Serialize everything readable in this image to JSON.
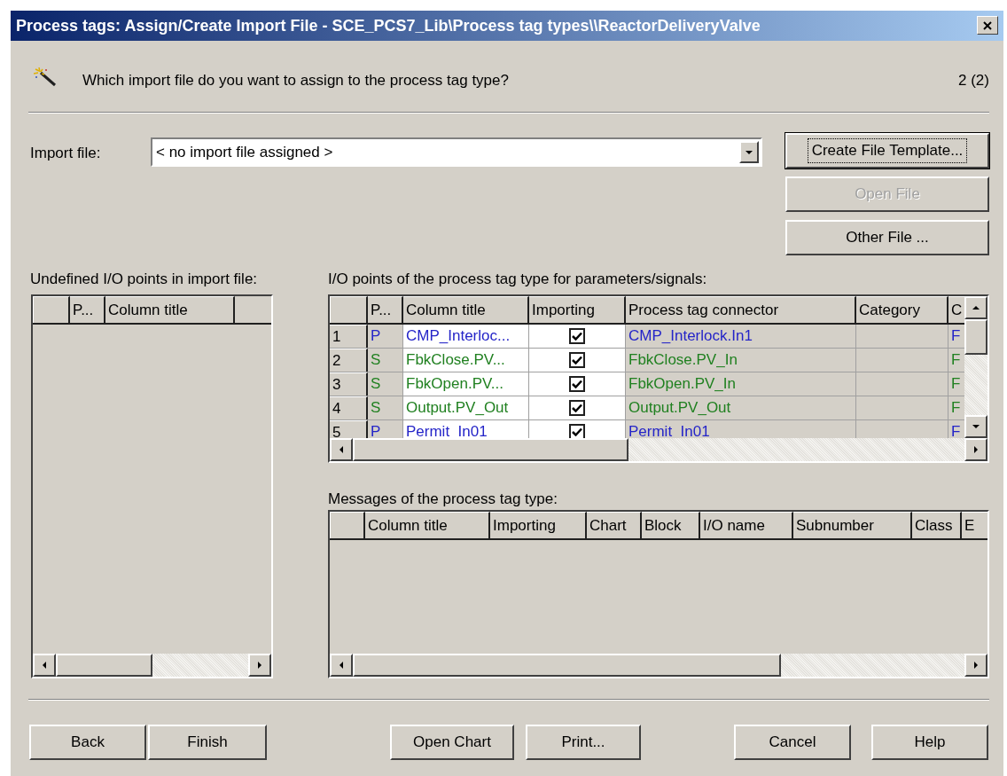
{
  "window": {
    "title": "Process tags: Assign/Create Import File - SCE_PCS7_Lib\\Process tag types\\\\ReactorDeliveryValve"
  },
  "header": {
    "question": "Which import file do you want to assign to the process tag type?",
    "step": "2 (2)"
  },
  "import_file": {
    "label": "Import file:",
    "value": "< no import file assigned >"
  },
  "side_buttons": [
    {
      "label": "Create File Template...",
      "focused": true,
      "disabled": false
    },
    {
      "label": "Open File",
      "focused": false,
      "disabled": true
    },
    {
      "label": "Other File ...",
      "focused": false,
      "disabled": false
    }
  ],
  "undefined_points": {
    "label": "Undefined I/O points in import file:",
    "columns": [
      "P...",
      "Column title"
    ]
  },
  "io_points": {
    "label": "I/O points of the process tag type for parameters/signals:",
    "columns": [
      "P...",
      "Column title",
      "Importing",
      "Process tag connector",
      "Category",
      "C"
    ],
    "rows": [
      {
        "number": "1",
        "type": "P",
        "color": "#2424c8",
        "column_title": "CMP_Interloc...",
        "importing": true,
        "connector": "CMP_Interlock.In1",
        "column_7": "F"
      },
      {
        "number": "2",
        "type": "S",
        "color": "#208020",
        "column_title": "FbkClose.PV...",
        "importing": true,
        "connector": "FbkClose.PV_In",
        "column_7": "F"
      },
      {
        "number": "3",
        "type": "S",
        "color": "#208020",
        "column_title": "FbkOpen.PV...",
        "importing": true,
        "connector": "FbkOpen.PV_In",
        "column_7": "F"
      },
      {
        "number": "4",
        "type": "S",
        "color": "#208020",
        "column_title": "Output.PV_Out",
        "importing": true,
        "connector": "Output.PV_Out",
        "column_7": "F"
      },
      {
        "number": "5",
        "type": "P",
        "color": "#2424c8",
        "column_title": "Permit_In01",
        "importing": true,
        "connector": "Permit_In01",
        "column_7": "F"
      }
    ]
  },
  "messages": {
    "label": "Messages of the process tag type:",
    "columns": [
      "Column title",
      "Importing",
      "Chart",
      "Block",
      "I/O name",
      "Subnumber",
      "Class",
      "E"
    ]
  },
  "footer_buttons": [
    {
      "label": "Back"
    },
    {
      "label": "Finish"
    },
    {
      "label": "Open Chart"
    },
    {
      "label": "Print..."
    },
    {
      "label": "Cancel"
    },
    {
      "label": "Help"
    }
  ]
}
